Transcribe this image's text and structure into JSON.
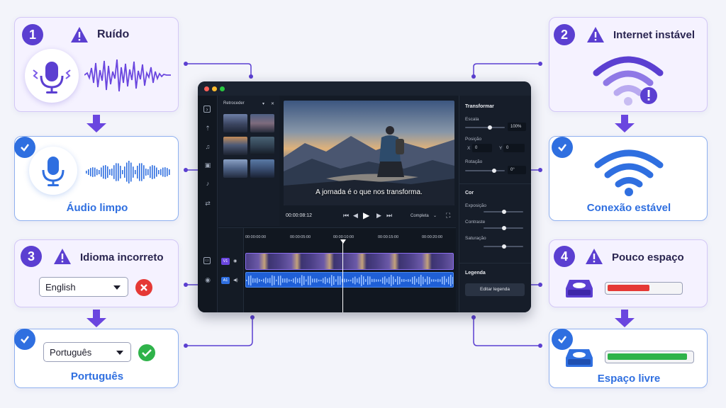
{
  "problems": [
    {
      "number": "1",
      "title": "Ruído"
    },
    {
      "number": "2",
      "title": "Internet instável"
    },
    {
      "number": "3",
      "title": "Idioma incorreto",
      "dropdown_value": "English"
    },
    {
      "number": "4",
      "title": "Pouco espaço",
      "storage_fill": 0.55
    }
  ],
  "solutions": [
    {
      "title": "Áudio limpo"
    },
    {
      "title": "Conexão estável"
    },
    {
      "title": "Português",
      "dropdown_value": "Português"
    },
    {
      "title": "Espaço livre",
      "storage_fill": 0.95
    }
  ],
  "colors": {
    "accent_purple": "#5b3fd1",
    "accent_blue": "#2f6fe0",
    "error_red": "#e53935",
    "success_green": "#2fb34a"
  },
  "editor": {
    "library_title": "Retroceder",
    "video_caption": "A jornada é o que nos transforma.",
    "timecode": "00:00:08:12",
    "quality": "Completa",
    "timeline_ticks": [
      "00:00:00:00",
      "00:00:05:00",
      "00:00:10:00",
      "00:00:15:00",
      "00:00:20:00"
    ],
    "track_video": "V1",
    "track_audio": "A1",
    "transform": {
      "heading": "Transformar",
      "scale_label": "Escala",
      "scale_value": "100%",
      "position_label": "Posição",
      "pos_x_label": "X",
      "pos_x_value": "0",
      "pos_y_label": "Y",
      "pos_y_value": "0",
      "rotation_label": "Rotação",
      "rotation_value": "0°"
    },
    "color": {
      "heading": "Cor",
      "exposure_label": "Exposição",
      "contrast_label": "Contraste",
      "saturation_label": "Saturação"
    },
    "subtitle": {
      "heading": "Legenda",
      "edit_button": "Editar legenda"
    }
  },
  "icons": [
    "microphone-icon",
    "wifi-icon",
    "hard-drive-icon",
    "warning-icon",
    "check-icon",
    "close-icon"
  ]
}
